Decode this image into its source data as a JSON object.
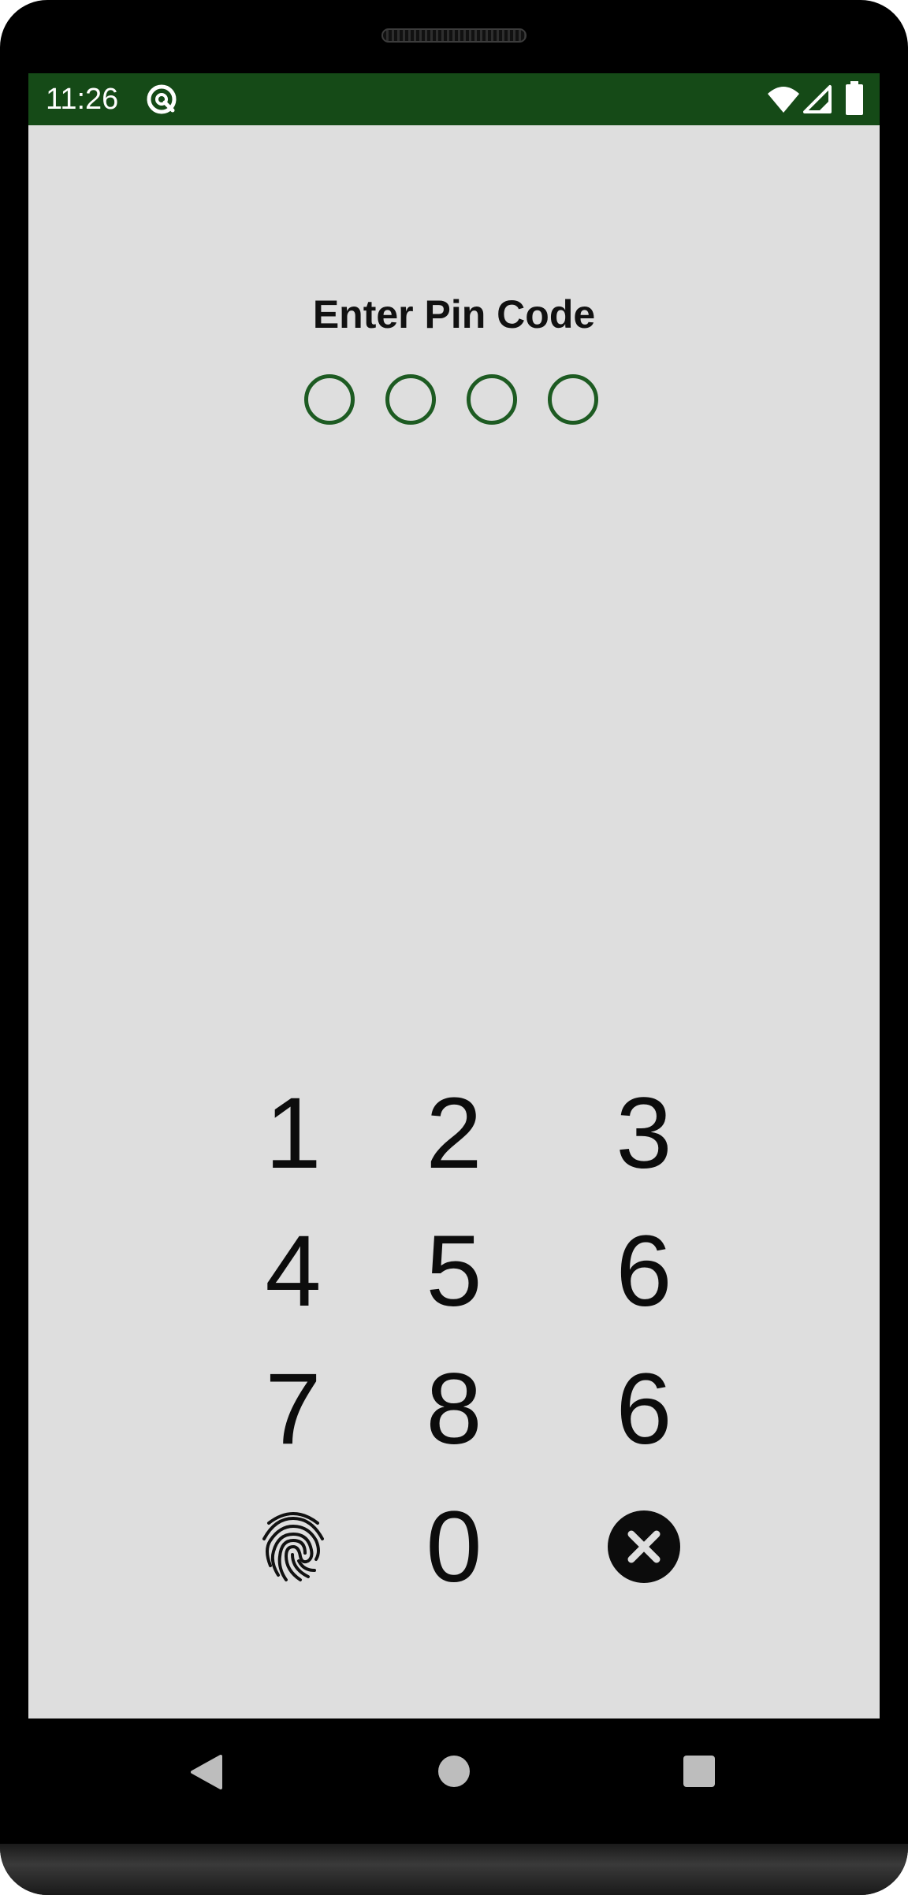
{
  "status_bar": {
    "time": "11:26",
    "background_color": "#154a17",
    "icons": [
      "at-sign-icon",
      "wifi-icon",
      "cellular-signal-icon",
      "battery-icon"
    ]
  },
  "pin_screen": {
    "title": "Enter Pin Code",
    "pin_length": 4,
    "entered_digits": 0,
    "accent_color": "#1d5b22",
    "background_color": "#dedede"
  },
  "keypad": {
    "keys": [
      "1",
      "2",
      "3",
      "4",
      "5",
      "6",
      "7",
      "8",
      "6",
      "0"
    ],
    "fingerprint_icon": "fingerprint-icon",
    "clear_icon": "clear-icon"
  },
  "navigation": {
    "icons": [
      "back-icon",
      "home-icon",
      "recents-icon"
    ]
  }
}
